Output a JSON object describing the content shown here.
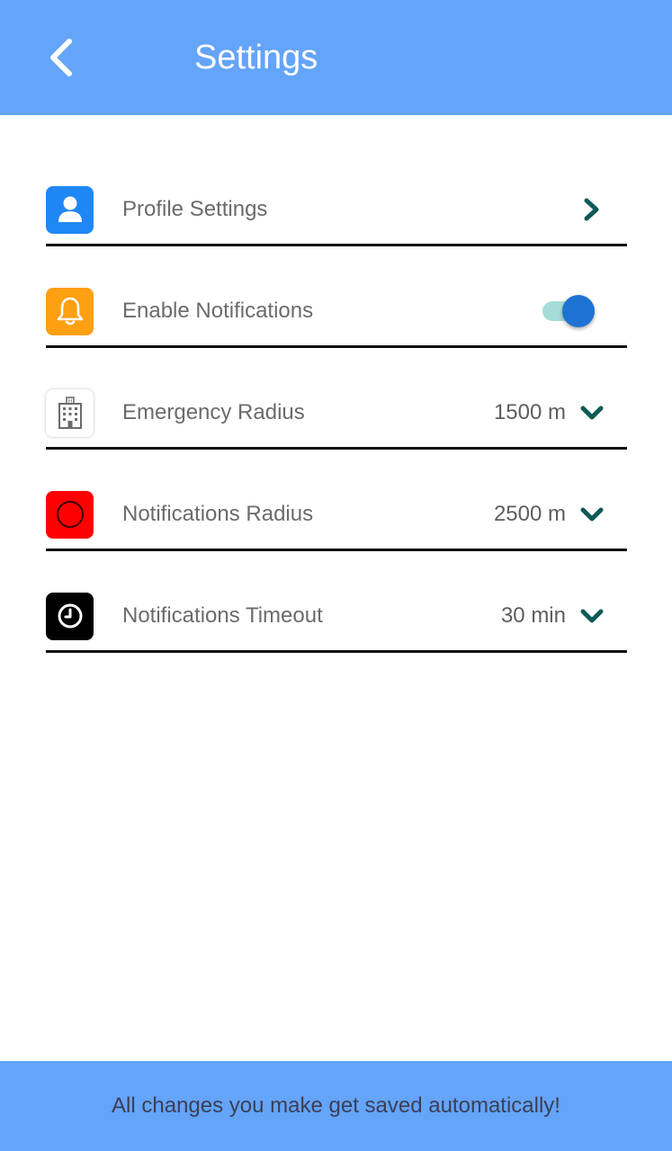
{
  "header": {
    "title": "Settings",
    "back_icon": "chevron-left-icon"
  },
  "settings": [
    {
      "label": "Profile Settings",
      "icon": "user-icon",
      "icon_color": "#1f87f5",
      "control": "chevron-right"
    },
    {
      "label": "Enable Notifications",
      "icon": "bell-icon",
      "icon_color": "#ff9f12",
      "control": "toggle",
      "enabled": true
    },
    {
      "label": "Emergency Radius",
      "icon": "hospital-icon",
      "icon_color": "#ffffff",
      "value": "1500 m",
      "control": "dropdown"
    },
    {
      "label": "Notifications Radius",
      "icon": "circle-icon",
      "icon_color": "#ff0000",
      "value": "2500 m",
      "control": "dropdown"
    },
    {
      "label": "Notifications Timeout",
      "icon": "clock-icon",
      "icon_color": "#000000",
      "value": "30 min",
      "control": "dropdown"
    }
  ],
  "footer": {
    "message": "All changes you make get saved automatically!"
  },
  "colors": {
    "header_bg": "#64a4f9",
    "footer_bg": "#64a4f9",
    "chevron": "#0d5a55",
    "toggle_thumb": "#1e73d2",
    "toggle_track": "#a6dcd8"
  }
}
